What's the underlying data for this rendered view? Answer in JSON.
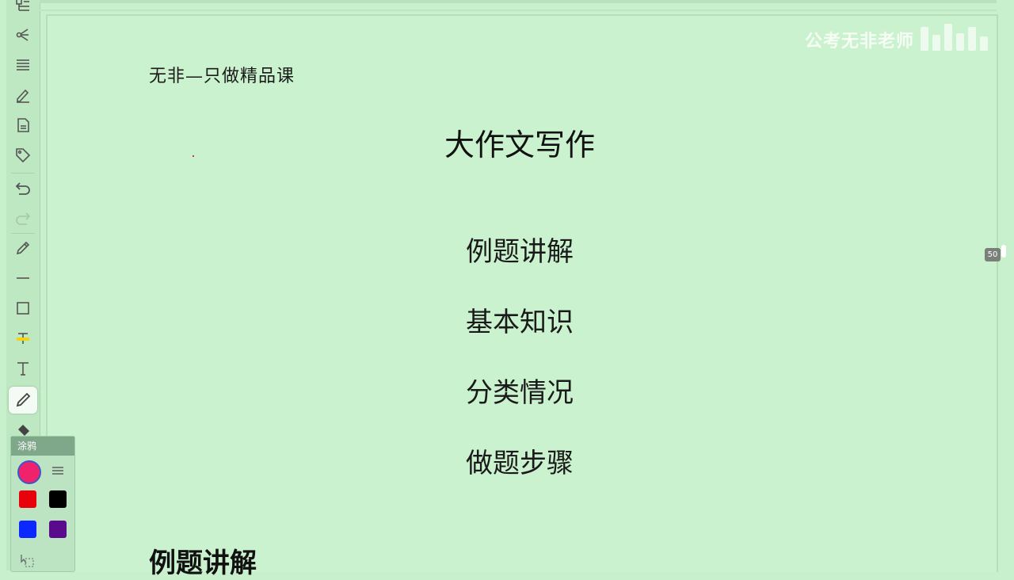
{
  "document": {
    "brand_line": "无非—只做精品课",
    "title": "大作文写作",
    "outline": [
      "例题讲解",
      "基本知识",
      "分类情况",
      "做题步骤"
    ],
    "section_heading": "例题讲解"
  },
  "watermark": {
    "text": "公考无非老师"
  },
  "page_indicator": "50",
  "toolbar": {
    "tools": [
      "outline-icon",
      "mind-map-icon",
      "list-icon",
      "signature-icon",
      "document-icon",
      "tag-icon",
      "undo-icon",
      "redo-icon",
      "pencil-icon",
      "line-icon",
      "rectangle-icon",
      "highlighter-icon",
      "text-icon",
      "pen-icon",
      "eraser-icon"
    ]
  },
  "palette": {
    "title": "涂鸦",
    "current_color": "#f0226c",
    "colors": [
      "#e8000a",
      "#000000",
      "#0a28ff",
      "#5a0a8c"
    ]
  },
  "colors": {
    "background": "#c9f0cc",
    "text": "#111111"
  }
}
